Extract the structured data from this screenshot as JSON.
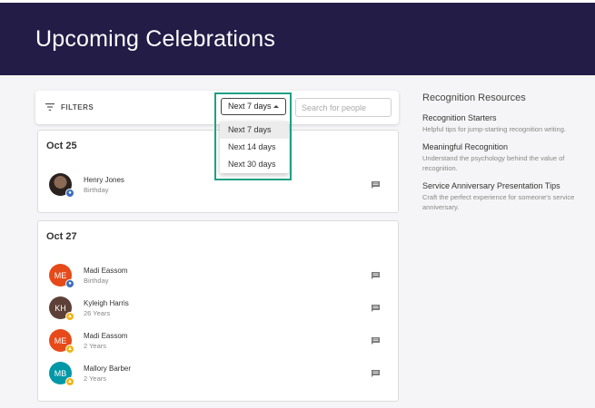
{
  "header": {
    "title": "Upcoming Celebrations"
  },
  "filters": {
    "label": "FILTERS",
    "range_selected": "Next 7 days",
    "range_options": [
      "Next 7 days",
      "Next 14 days",
      "Next 30 days"
    ],
    "search_placeholder": "Search for people"
  },
  "groups": [
    {
      "date": "Oct 25",
      "people": [
        {
          "name": "Henry Jones",
          "detail": "Birthday",
          "initials": "",
          "avatar_color": "#2b2220",
          "badge": "cake-icon"
        }
      ]
    },
    {
      "date": "Oct 27",
      "people": [
        {
          "name": "Madi Eassom",
          "detail": "Birthday",
          "initials": "ME",
          "avatar_color": "#e64a19",
          "badge": "cake-icon"
        },
        {
          "name": "Kyleigh Harris",
          "detail": "26 Years",
          "initials": "KH",
          "avatar_color": "#5d4037",
          "badge": "trophy-icon"
        },
        {
          "name": "Madi Eassom",
          "detail": "2 Years",
          "initials": "ME",
          "avatar_color": "#e64a19",
          "badge": "trophy-icon"
        },
        {
          "name": "Mallory Barber",
          "detail": "2 Years",
          "initials": "MB",
          "avatar_color": "#0097a7",
          "badge": "trophy-icon"
        }
      ]
    }
  ],
  "resources": {
    "title": "Recognition Resources",
    "items": [
      {
        "title": "Recognition Starters",
        "description": "Helpful tips for jump-starting recognition writing."
      },
      {
        "title": "Meaningful Recognition",
        "description": "Understand the psychology behind the value of recognition."
      },
      {
        "title": "Service Anniversary Presentation Tips",
        "description": "Craft the perfect experience for someone's service anniversary."
      }
    ]
  },
  "colors": {
    "header_bg": "#231c47",
    "highlight": "#20a085",
    "cake_badge": "#3a6fbd",
    "trophy_badge": "#f2b417"
  }
}
